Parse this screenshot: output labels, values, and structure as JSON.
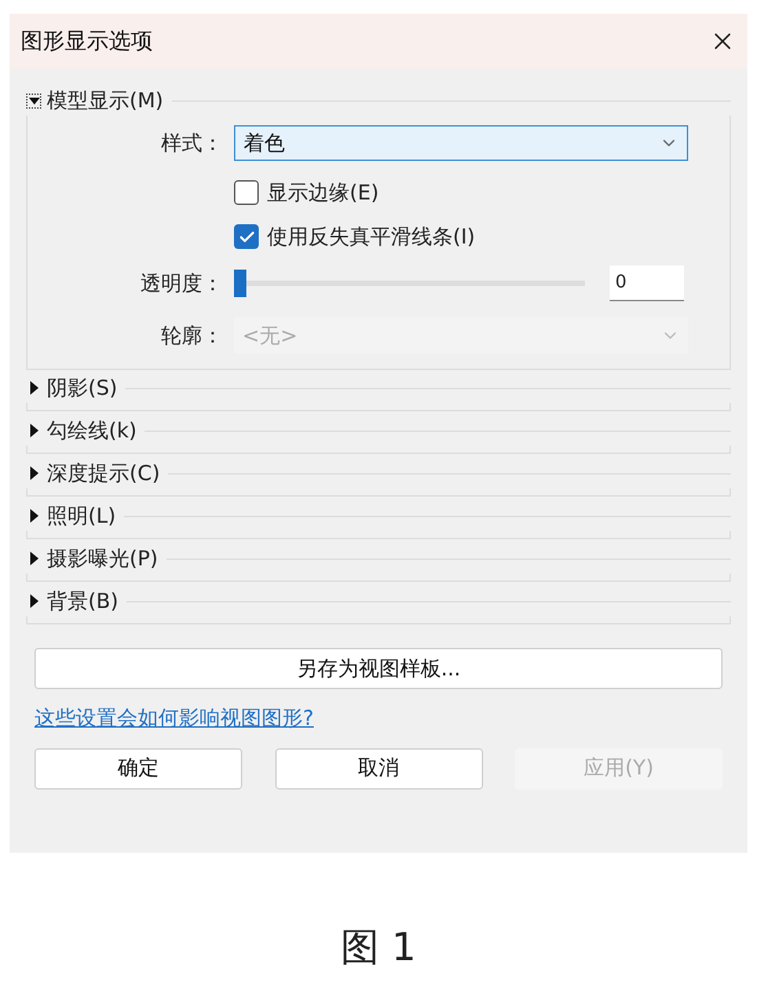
{
  "window": {
    "title": "图形显示选项"
  },
  "sections": [
    {
      "label": "模型显示(M)",
      "expanded": true,
      "controls": [
        {
          "kind": "dropdown",
          "label": "样式：",
          "value": "着色",
          "disabled": false
        },
        {
          "kind": "checkbox",
          "label": "显示边缘(E)",
          "checked": false
        },
        {
          "kind": "checkbox",
          "label": "使用反失真平滑线条(I)",
          "checked": true
        },
        {
          "kind": "slider",
          "label": "透明度：",
          "level": 0,
          "value": "0"
        },
        {
          "kind": "dropdown",
          "label": "轮廓：",
          "value": "<无>",
          "disabled": true
        }
      ]
    },
    {
      "label": "阴影(S)",
      "expanded": false
    },
    {
      "label": "勾绘线(k)",
      "expanded": false
    },
    {
      "label": "深度提示(C)",
      "expanded": false
    },
    {
      "label": "照明(L)",
      "expanded": false
    },
    {
      "label": "摄影曝光(P)",
      "expanded": false
    },
    {
      "label": "背景(B)",
      "expanded": false
    }
  ],
  "save_template_button": "另存为视图样板...",
  "help_link": "这些设置会如何影响视图图形?",
  "buttons": [
    {
      "label": "确定",
      "disabled": false
    },
    {
      "label": "取消",
      "disabled": false
    },
    {
      "label": "应用(Y)",
      "disabled": true
    }
  ],
  "caption": "图 1"
}
